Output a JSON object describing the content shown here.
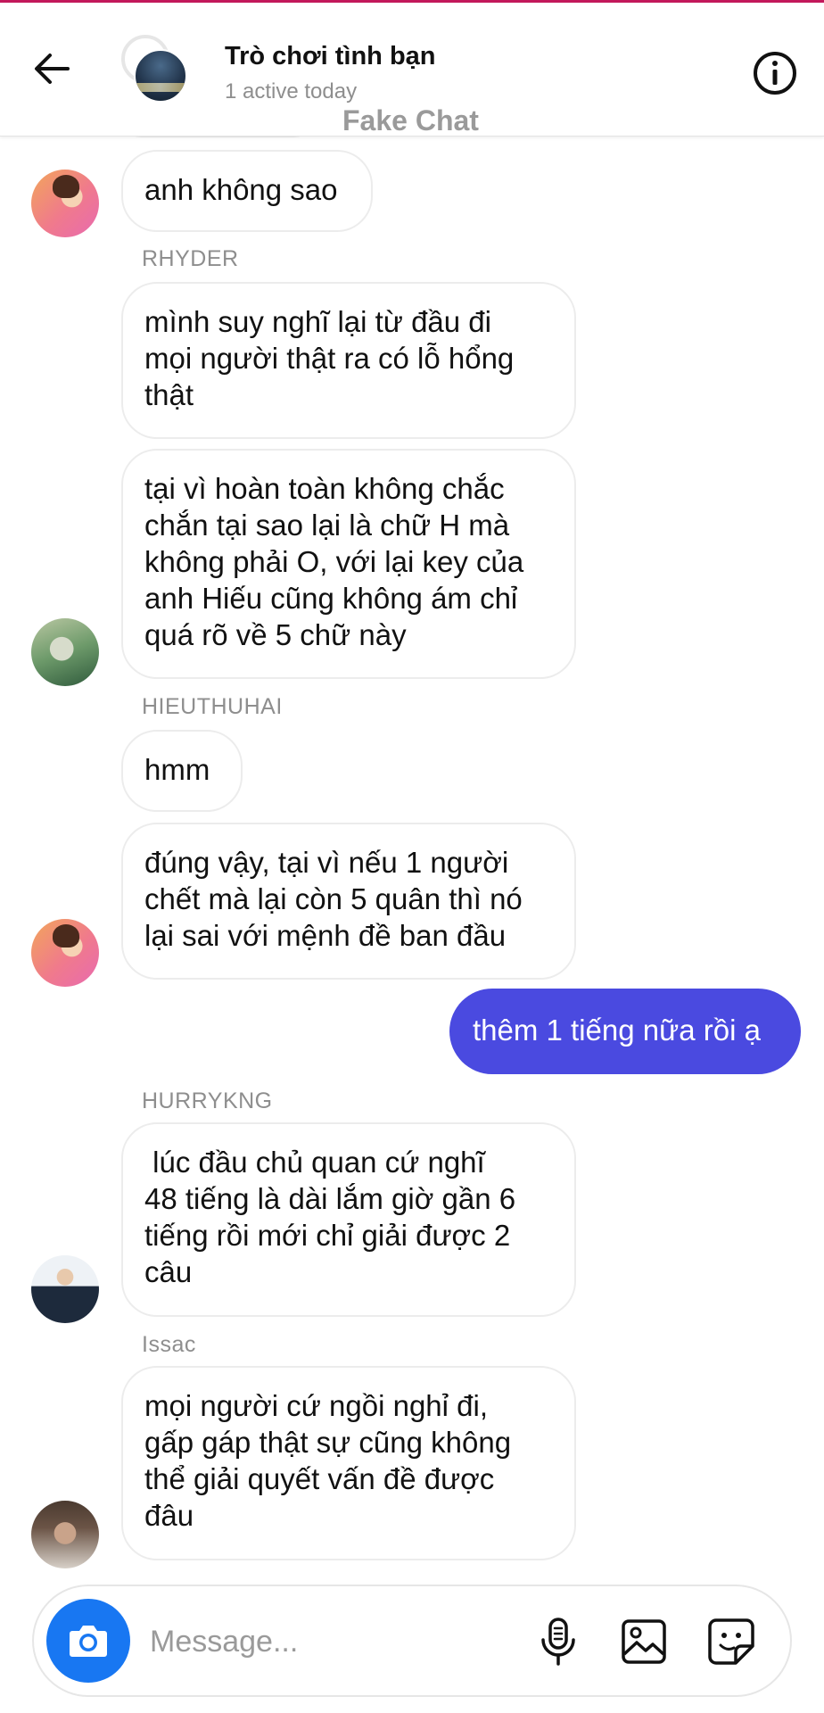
{
  "header": {
    "title": "Trò chơi tình bạn",
    "status": "1 active today",
    "watermark": "Fake Chat"
  },
  "icons": {
    "back": "back-arrow-icon",
    "info": "info-icon",
    "camera": "camera-icon",
    "mic": "microphone-icon",
    "gallery": "image-icon",
    "sticker": "sticker-icon"
  },
  "messages": {
    "m1": {
      "text": "anh không sao"
    },
    "s_rhyder": "RHYDER",
    "m2": {
      "l1": "mình suy nghĩ lại từ đầu đi",
      "l2": "mọi người thật ra có lỗ hổng",
      "l3": "thật"
    },
    "m3": {
      "l1": "tại vì hoàn toàn không chắc",
      "l2": "chắn tại sao lại là chữ H mà",
      "l3": "không phải O, với lại key của",
      "l4": "anh Hiếu cũng không ám chỉ",
      "l5": "quá rõ về 5 chữ này"
    },
    "s_hieu": "HIEUTHUHAI",
    "m4": {
      "text": "hmm"
    },
    "m5": {
      "l1": "đúng vậy, tại vì nếu 1 người",
      "l2": "chết mà lại còn 5 quân thì nó",
      "l3": "lại sai với mệnh đề ban đầu"
    },
    "m6": {
      "text": "thêm 1 tiếng nữa rồi ạ"
    },
    "s_hurry": "HURRYKNG",
    "m7": {
      "l1": " lúc đầu chủ quan cứ nghĩ",
      "l2": "48 tiếng là dài lắm giờ gần 6",
      "l3": "tiếng rồi mới chỉ giải được 2",
      "l4": "câu"
    },
    "s_issac": "Issac",
    "m8": {
      "l1": "mọi người cứ ngồi nghỉ đi,",
      "l2": "gấp gáp thật sự cũng không",
      "l3": "thể giải quyết vấn đề được",
      "l4": "đâu"
    }
  },
  "composer": {
    "placeholder": "Message..."
  },
  "colors": {
    "outgoing_bubble": "#4a4ae0",
    "camera_button": "#1877f2",
    "top_accent": "#c2185b"
  }
}
